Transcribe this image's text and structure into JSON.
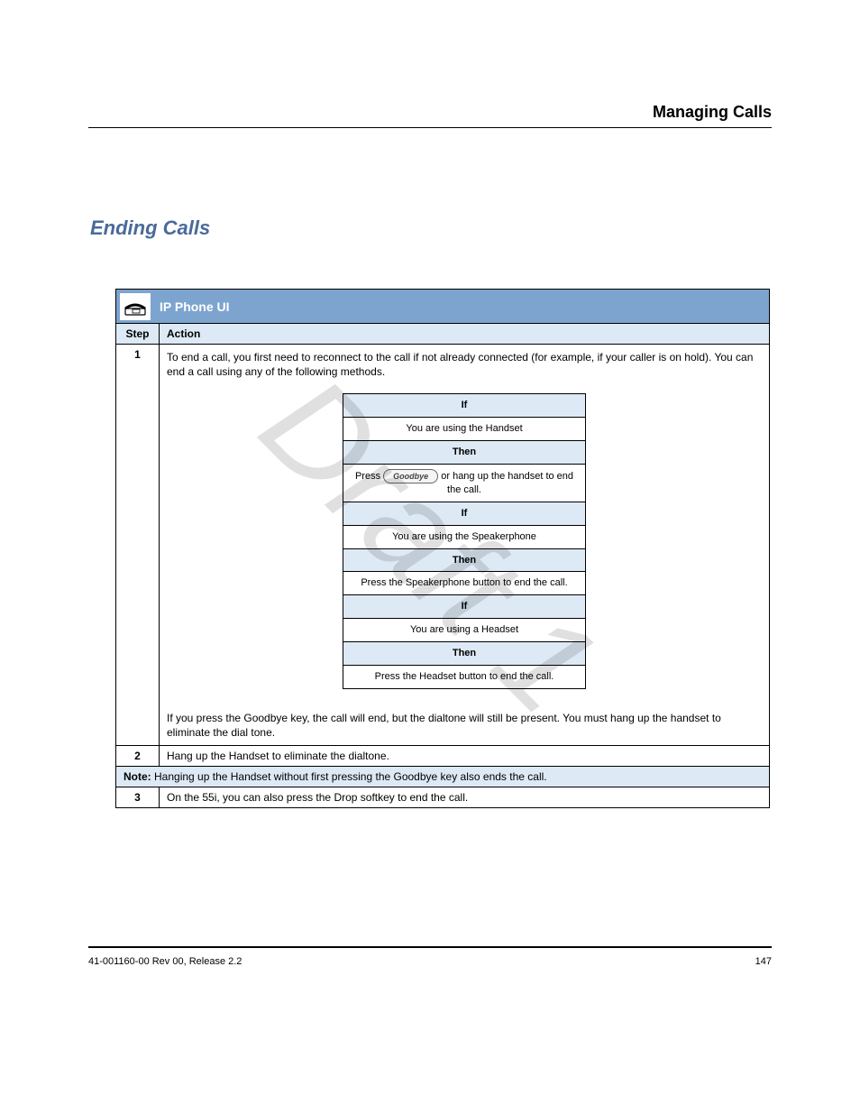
{
  "watermark": "Draft 1",
  "header": {
    "title": "Managing Calls"
  },
  "section": {
    "title": "Ending Calls",
    "intro_text": ""
  },
  "table": {
    "title": "IP Phone UI",
    "columns": {
      "step": "Step",
      "action": "Action"
    },
    "row1": {
      "step": "1",
      "intro": "To end a call, you first need to reconnect to the call if not already connected (for example, if your caller is on hold). You can end a call using any of the following methods.",
      "inner": {
        "if_header": "If",
        "if_body_1": "You are using the Handset",
        "then_header_1": "Then",
        "then_body_1_pre": "Press ",
        "then_body_1_goodbye": "Goodbye",
        "then_body_1_post": " or hang up the handset to end the call.",
        "if_body_2": "You are using the Speakerphone",
        "then_header_2": "Then",
        "then_body_2": "Press the Speakerphone button to end the call.",
        "if_body_3": "You are using a Headset",
        "then_header_3": "Then",
        "then_body_3": "Press the Headset button to end the call."
      },
      "outro": "If you press the Goodbye key, the call will end, but the dialtone will still be present. You must hang up the handset to eliminate the dial tone."
    },
    "row2": {
      "step": "2",
      "text": "Hang up the Handset to eliminate the dialtone."
    },
    "note_label": "Note:",
    "note_text": " Hanging up the Handset without first pressing the Goodbye key also ends the call.",
    "row3": {
      "step": "3",
      "text": "On the 55i, you can also press the Drop softkey to end the call."
    }
  },
  "footer": {
    "left": "41-001160-00 Rev 00, Release 2.2",
    "right": "147"
  }
}
